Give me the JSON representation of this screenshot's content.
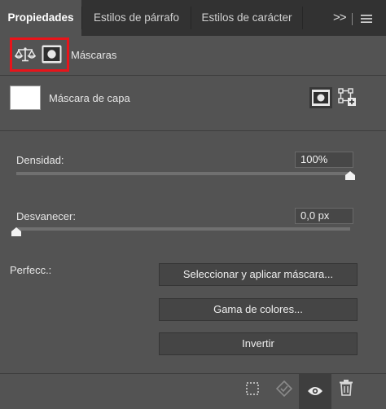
{
  "tabs": [
    {
      "label": "Propiedades",
      "active": true
    },
    {
      "label": "Estilos de párrafo",
      "active": false
    },
    {
      "label": "Estilos de carácter",
      "active": false
    }
  ],
  "toolbar_icons": [
    "double-chevron-right-icon",
    "panel-menu-icon"
  ],
  "overflow_label": ">>",
  "header": {
    "title": "Máscaras",
    "icons": [
      "adjustment-scale-icon",
      "layer-mask-icon"
    ]
  },
  "mask": {
    "label": "Máscara de capa",
    "actions": [
      "add-pixel-mask-icon",
      "add-vector-mask-icon"
    ]
  },
  "density": {
    "label": "Densidad:",
    "value": "100%",
    "level": 1.0
  },
  "feather": {
    "label": "Desvanecer:",
    "value": "0,0 px",
    "level": 0.0
  },
  "refine": {
    "label": "Perfecc.:",
    "buttons": [
      "Seleccionar y aplicar máscara...",
      "Gama de colores...",
      "Invertir"
    ]
  },
  "footer_icons": [
    "load-selection-icon",
    "apply-mask-icon",
    "visibility-eye-icon",
    "trash-icon"
  ],
  "highlight_color": "#e8141a"
}
